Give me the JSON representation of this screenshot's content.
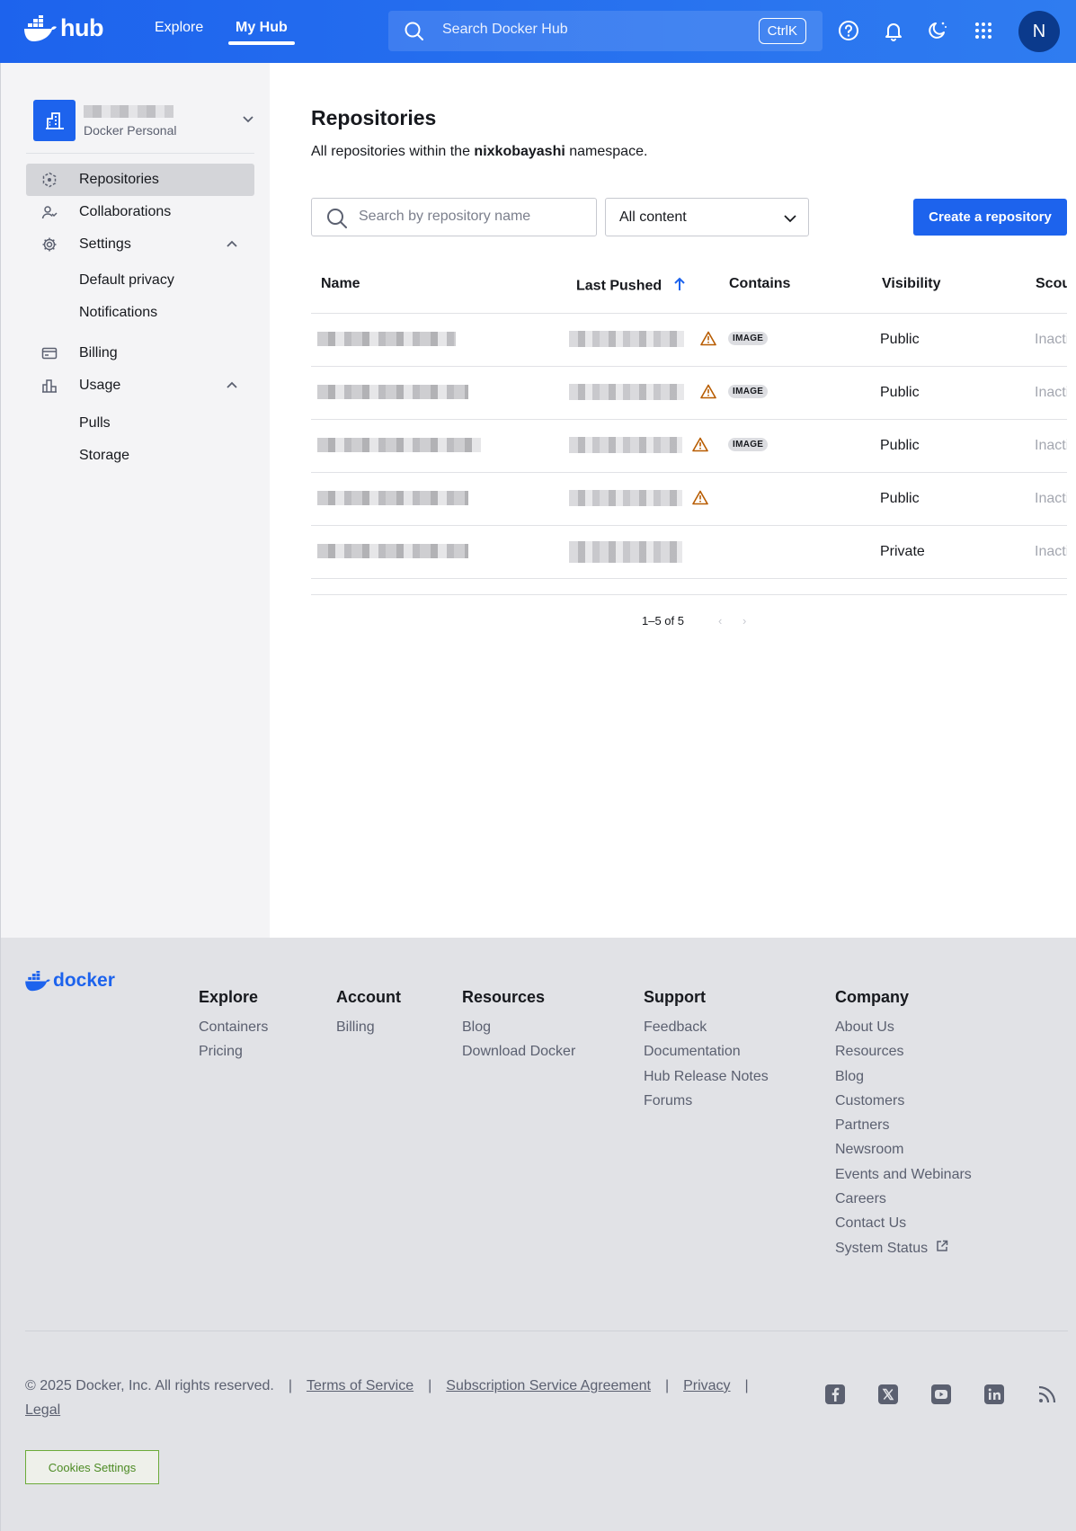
{
  "header": {
    "logo_text": "hub",
    "nav": {
      "explore": "Explore",
      "my_hub": "My Hub"
    },
    "search": {
      "placeholder": "Search Docker Hub",
      "shortcut": "CtrlK"
    },
    "avatar_initial": "N",
    "brand_color": "#1d63ed"
  },
  "sidebar": {
    "org_subtitle": "Docker Personal",
    "items": [
      {
        "label": "Repositories",
        "icon": "repositories-icon",
        "active": true
      },
      {
        "label": "Collaborations",
        "icon": "collaborations-icon"
      },
      {
        "label": "Settings",
        "icon": "gear-icon",
        "expanded": true
      },
      {
        "label": "Billing",
        "icon": "credit-card-icon"
      },
      {
        "label": "Usage",
        "icon": "bar-chart-icon",
        "expanded": true
      }
    ],
    "settings_sub": [
      "Default privacy",
      "Notifications"
    ],
    "usage_sub": [
      "Pulls",
      "Storage"
    ]
  },
  "main": {
    "title": "Repositories",
    "desc_prefix": "All repositories within the ",
    "namespace": "nixkobayashi",
    "desc_suffix": " namespace.",
    "search_placeholder": "Search by repository name",
    "content_filter": "All content",
    "create_button": "Create a repository",
    "columns": [
      "Name",
      "Last Pushed",
      "Contains",
      "Visibility",
      "Scout"
    ],
    "rows": [
      {
        "warning": true,
        "contains": "IMAGE",
        "visibility": "Public",
        "scout": "Inactive"
      },
      {
        "warning": true,
        "contains": "IMAGE",
        "visibility": "Public",
        "scout": "Inactive"
      },
      {
        "warning": true,
        "contains": "IMAGE",
        "visibility": "Public",
        "scout": "Inactive"
      },
      {
        "warning": true,
        "contains": "",
        "visibility": "Public",
        "scout": "Inactive"
      },
      {
        "warning": false,
        "contains": "",
        "visibility": "Private",
        "scout": "Inactive"
      }
    ],
    "pagination": "1–5 of 5"
  },
  "footer": {
    "logo_text": "docker",
    "columns": [
      {
        "title": "Explore",
        "links": [
          "Containers",
          "Pricing"
        ]
      },
      {
        "title": "Account",
        "links": [
          "Billing"
        ]
      },
      {
        "title": "Resources",
        "links": [
          "Blog",
          "Download Docker"
        ]
      },
      {
        "title": "Support",
        "links": [
          "Feedback",
          "Documentation",
          "Hub Release Notes",
          "Forums"
        ]
      },
      {
        "title": "Company",
        "links": [
          "About Us",
          "Resources",
          "Blog",
          "Customers",
          "Partners",
          "Newsroom",
          "Events and Webinars",
          "Careers",
          "Contact Us",
          "System Status"
        ]
      }
    ],
    "copyright": "© 2025 Docker, Inc. All rights reserved.",
    "legal_links": [
      "Terms of Service",
      "Subscription Service Agreement",
      "Privacy",
      "Legal"
    ],
    "social_icons": [
      "facebook-icon",
      "x-icon",
      "youtube-icon",
      "linkedin-icon",
      "rss-icon"
    ],
    "cookies_button": "Cookies Settings"
  }
}
